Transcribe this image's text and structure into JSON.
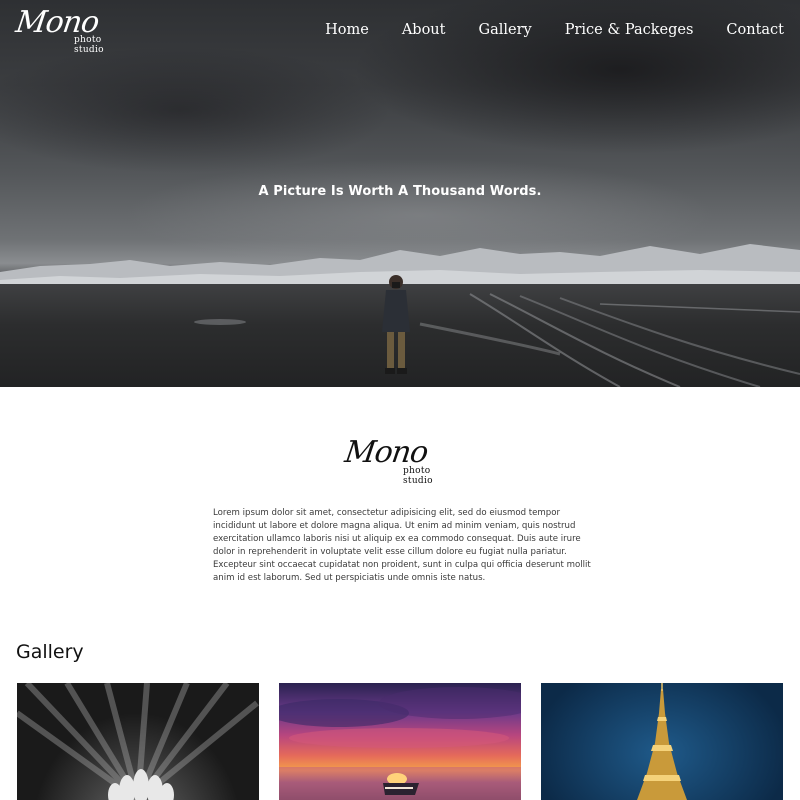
{
  "brand": {
    "name": "Mono",
    "subtitle": "photo studio"
  },
  "nav": {
    "items": [
      {
        "label": "Home"
      },
      {
        "label": "About"
      },
      {
        "label": "Gallery"
      },
      {
        "label": "Price & Packeges"
      },
      {
        "label": "Contact"
      }
    ]
  },
  "hero": {
    "tagline": "A Picture Is Worth A Thousand Words."
  },
  "about": {
    "text": "Lorem ipsum dolor sit amet, consectetur adipisicing elit, sed do eiusmod tempor incididunt ut labore et dolore magna aliqua. Ut enim ad minim veniam, quis nostrud exercitation ullamco laboris nisi ut aliquip ex ea commodo consequat. Duis aute irure dolor in reprehenderit in voluptate velit esse cillum dolore eu fugiat nulla pariatur. Excepteur sint occaecat cupidatat non proident, sunt in culpa qui officia deserunt mollit anim id est laborum. Sed ut perspiciatis unde omnis iste natus."
  },
  "gallery": {
    "title": "Gallery",
    "images": [
      {
        "name": "flower-bw-photo"
      },
      {
        "name": "sunset-boat-photo"
      },
      {
        "name": "eiffel-tower-night-photo"
      }
    ]
  }
}
